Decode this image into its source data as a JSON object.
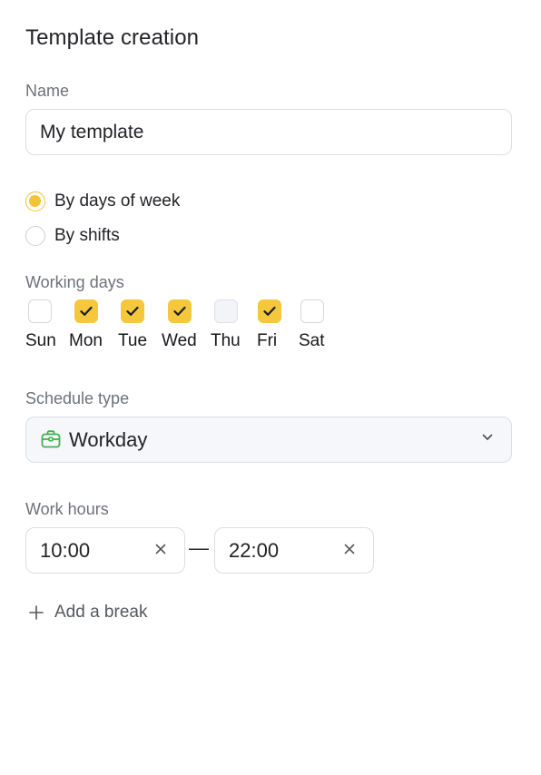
{
  "title": "Template creation",
  "name": {
    "label": "Name",
    "value": "My template"
  },
  "mode": {
    "options": [
      {
        "label": "By days of week",
        "selected": true
      },
      {
        "label": "By shifts",
        "selected": false
      }
    ]
  },
  "working_days": {
    "label": "Working days",
    "days": [
      {
        "label": "Sun",
        "checked": false,
        "disabled": false
      },
      {
        "label": "Mon",
        "checked": true,
        "disabled": false
      },
      {
        "label": "Tue",
        "checked": true,
        "disabled": false
      },
      {
        "label": "Wed",
        "checked": true,
        "disabled": false
      },
      {
        "label": "Thu",
        "checked": false,
        "disabled": true
      },
      {
        "label": "Fri",
        "checked": true,
        "disabled": false
      },
      {
        "label": "Sat",
        "checked": false,
        "disabled": false
      }
    ]
  },
  "schedule_type": {
    "label": "Schedule type",
    "value": "Workday",
    "icon": "briefcase-icon",
    "icon_color": "#3fb24f"
  },
  "work_hours": {
    "label": "Work hours",
    "start": "10:00",
    "separator": "—",
    "end": "22:00"
  },
  "add_break": {
    "label": "Add a break"
  },
  "colors": {
    "accent": "#f5c73d",
    "muted_text": "#6e717a",
    "border": "#dcdee3"
  }
}
